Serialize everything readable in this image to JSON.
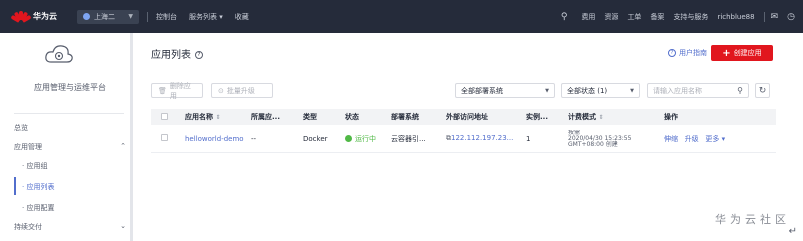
{
  "topbar": {
    "brand": "华为云",
    "brand_sub": "HUAWEI",
    "region": "上海二",
    "items": [
      "控制台",
      "服务列表",
      "收藏"
    ],
    "right_items": [
      "费用",
      "资源",
      "工单",
      "备案",
      "支持与服务"
    ],
    "username": "richblue88",
    "colors": {
      "bg": "#252b3a",
      "accent": "#e1161e"
    }
  },
  "sidebar": {
    "title": "应用管理与运维平台",
    "items": [
      {
        "label": "总览",
        "type": "item"
      },
      {
        "label": "应用管理",
        "type": "group",
        "expanded": true,
        "chevron": "^"
      },
      {
        "label": "应用组",
        "type": "sub"
      },
      {
        "label": "应用列表",
        "type": "sub",
        "active": true
      },
      {
        "label": "应用配置",
        "type": "sub"
      },
      {
        "label": "持续交付",
        "type": "group",
        "expanded": false,
        "chevron": "v"
      }
    ]
  },
  "main": {
    "title": "应用列表",
    "guide": "用户指南",
    "create": "创建应用",
    "toolbar": {
      "delete": "删除应用",
      "batch_upgrade": "批量升级",
      "system_filter": "全部部署系统",
      "status_filter": "全部状态 (1)",
      "search_placeholder": "请输入应用名称"
    },
    "columns": [
      "应用名称",
      "所属应...",
      "类型",
      "状态",
      "部署系统",
      "外部访问地址",
      "实例...",
      "计费模式",
      "操作"
    ],
    "rows": [
      {
        "name": "helloworld-demo",
        "group": "--",
        "type": "Docker",
        "status": "运行中",
        "system": "云容器引...",
        "address": "122.112.197.23...",
        "instances": "1",
        "billing_1": "按需",
        "billing_2": "2020/04/30 15:23:55",
        "billing_3": "GMT+08:00 创建",
        "actions": [
          "伸缩",
          "升级",
          "更多"
        ]
      }
    ]
  },
  "watermark": "华为云社区",
  "colors": {
    "link": "#526ecc",
    "running": "#50b946",
    "primary": "#e1161e"
  }
}
